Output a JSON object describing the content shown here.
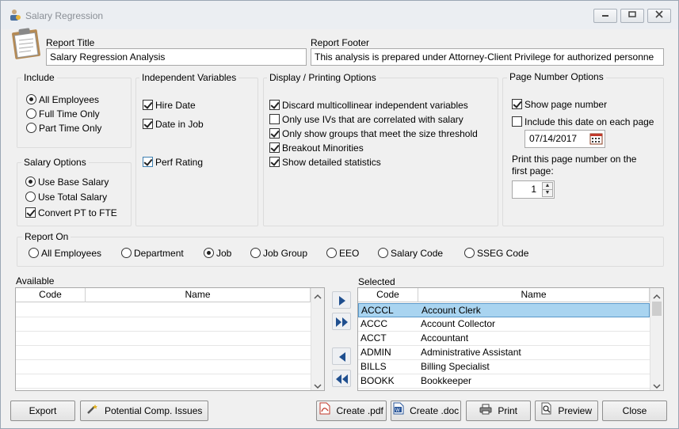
{
  "window": {
    "title": "Salary Regression",
    "minimize_label": "▭",
    "maximize_label": "▣",
    "close_label": "✕"
  },
  "report": {
    "title_label": "Report Title",
    "title_value": "Salary Regression Analysis",
    "footer_label": "Report Footer",
    "footer_value": "This analysis is prepared under Attorney-Client Privilege for authorized personne"
  },
  "include": {
    "title": "Include",
    "options": [
      "All Employees",
      "Full Time Only",
      "Part Time Only"
    ],
    "selected": "All Employees"
  },
  "salary_options": {
    "title": "Salary Options",
    "radios": [
      "Use Base Salary",
      "Use Total Salary"
    ],
    "selected": "Use Base Salary",
    "convert_label": "Convert PT to FTE",
    "convert_checked": true
  },
  "independent_variables": {
    "title": "Independent Variables",
    "items": [
      {
        "label": "Hire Date",
        "checked": true
      },
      {
        "label": "Date in Job",
        "checked": true
      },
      {
        "label": "Perf Rating",
        "checked": true
      }
    ]
  },
  "display_printing": {
    "title": "Display / Printing Options",
    "items": [
      {
        "label": "Discard multicollinear independent variables",
        "checked": true
      },
      {
        "label": "Only use IVs that are correlated with salary",
        "checked": false
      },
      {
        "label": "Only show groups that meet the size threshold",
        "checked": true
      },
      {
        "label": "Breakout Minorities",
        "checked": true
      },
      {
        "label": "Show detailed statistics",
        "checked": true
      }
    ]
  },
  "page_number": {
    "title": "Page Number Options",
    "show_label": "Show page number",
    "show_checked": true,
    "include_date_label": "Include this date on each page",
    "include_date_checked": false,
    "date_value": "07/14/2017",
    "first_page_label_line1": "Print this page number on the",
    "first_page_label_line2": "first page:",
    "first_page_value": "1"
  },
  "report_on": {
    "title": "Report On",
    "options": [
      "All Employees",
      "Department",
      "Job",
      "Job Group",
      "EEO",
      "Salary Code",
      "SSEG Code"
    ],
    "selected": "Job"
  },
  "available": {
    "label": "Available",
    "columns": [
      "Code",
      "Name"
    ],
    "rows": []
  },
  "selected": {
    "label": "Selected",
    "columns": [
      "Code",
      "Name"
    ],
    "rows": [
      {
        "code": "ACCCL",
        "name": "Account Clerk"
      },
      {
        "code": "ACCC",
        "name": "Account Collector"
      },
      {
        "code": "ACCT",
        "name": "Accountant"
      },
      {
        "code": "ADMIN",
        "name": "Administrative Assistant"
      },
      {
        "code": "BILLS",
        "name": "Billing Specialist"
      },
      {
        "code": "BOOKK",
        "name": "Bookkeeper"
      }
    ]
  },
  "buttons": {
    "export": "Export",
    "potential": "Potential Comp. Issues",
    "create_pdf": "Create .pdf",
    "create_doc": "Create .doc",
    "print": "Print",
    "preview": "Preview",
    "close": "Close"
  }
}
